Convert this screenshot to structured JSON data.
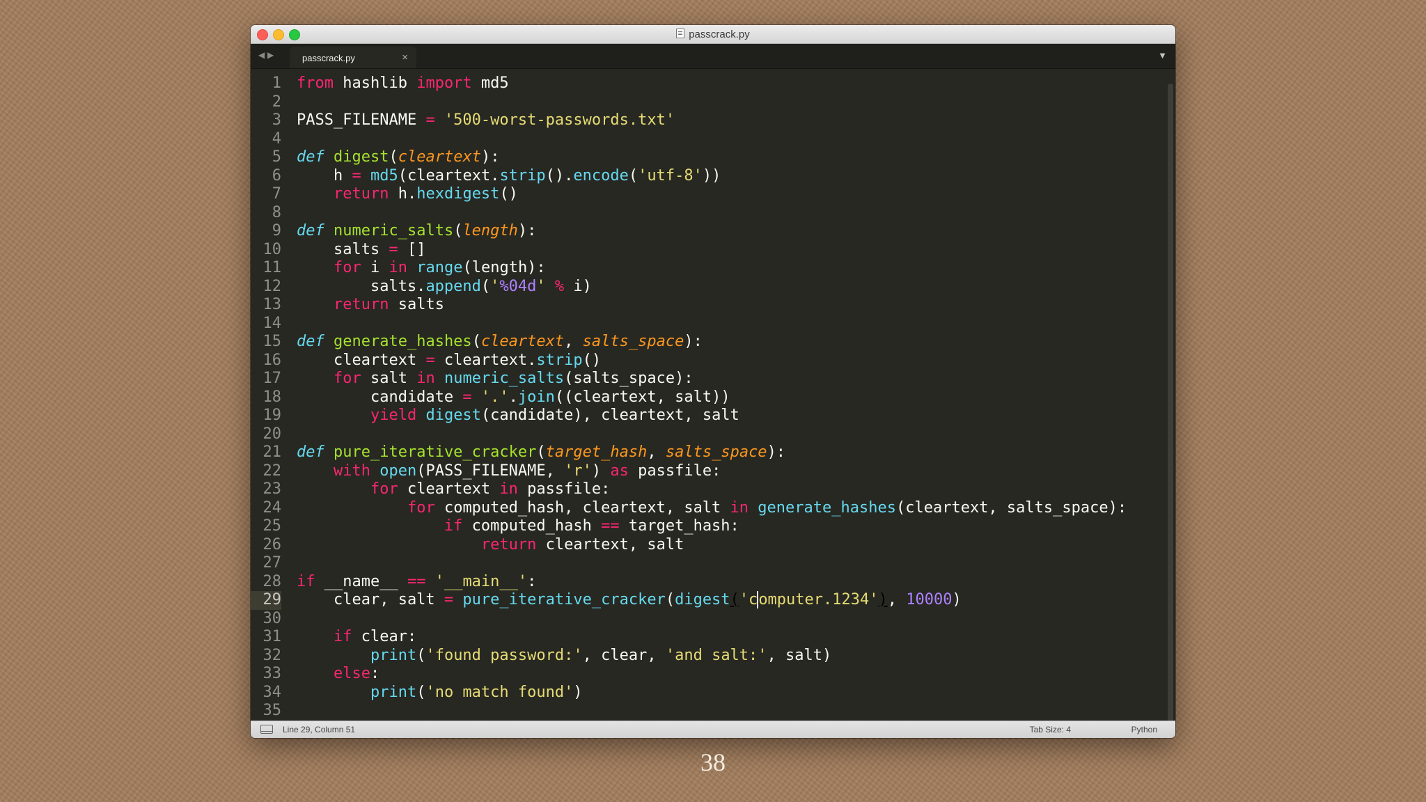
{
  "window": {
    "title": "passcrack.py"
  },
  "tabs": [
    {
      "label": "passcrack.py",
      "close": "×"
    }
  ],
  "nav": {
    "back": "◀",
    "forward": "▶",
    "dropdown": "▼"
  },
  "statusbar": {
    "position": "Line 29, Column 51",
    "tab_size": "Tab Size: 4",
    "syntax": "Python"
  },
  "slide_number": "38",
  "colors": {
    "keyword": "#f92672",
    "function": "#a6e22e",
    "builtin": "#66d9ef",
    "argument": "#fd971f",
    "string": "#e6db74",
    "number": "#ae81ff",
    "text": "#f8f8f2",
    "background": "#272822"
  },
  "editor": {
    "current_line": 29,
    "lines": [
      [
        [
          "kw",
          "from"
        ],
        [
          "pl",
          " hashlib "
        ],
        [
          "kw",
          "import"
        ],
        [
          "pl",
          " md5"
        ]
      ],
      [],
      [
        [
          "pl",
          "PASS_FILENAME "
        ],
        [
          "kw",
          "="
        ],
        [
          "pl",
          " "
        ],
        [
          "str",
          "'500-worst-passwords.txt'"
        ]
      ],
      [],
      [
        [
          "def",
          "def"
        ],
        [
          "pl",
          " "
        ],
        [
          "fn",
          "digest"
        ],
        [
          "pl",
          "("
        ],
        [
          "arg",
          "cleartext"
        ],
        [
          "pl",
          "):"
        ]
      ],
      [
        [
          "pl",
          "    h "
        ],
        [
          "kw",
          "="
        ],
        [
          "pl",
          " "
        ],
        [
          "bi",
          "md5"
        ],
        [
          "pl",
          "(cleartext."
        ],
        [
          "bi",
          "strip"
        ],
        [
          "pl",
          "()."
        ],
        [
          "bi",
          "encode"
        ],
        [
          "pl",
          "("
        ],
        [
          "str",
          "'utf-8'"
        ],
        [
          "pl",
          "))"
        ]
      ],
      [
        [
          "pl",
          "    "
        ],
        [
          "kw",
          "return"
        ],
        [
          "pl",
          " h."
        ],
        [
          "bi",
          "hexdigest"
        ],
        [
          "pl",
          "()"
        ]
      ],
      [],
      [
        [
          "def",
          "def"
        ],
        [
          "pl",
          " "
        ],
        [
          "fn",
          "numeric_salts"
        ],
        [
          "pl",
          "("
        ],
        [
          "arg",
          "length"
        ],
        [
          "pl",
          "):"
        ]
      ],
      [
        [
          "pl",
          "    salts "
        ],
        [
          "kw",
          "="
        ],
        [
          "pl",
          " []"
        ]
      ],
      [
        [
          "pl",
          "    "
        ],
        [
          "kw",
          "for"
        ],
        [
          "pl",
          " i "
        ],
        [
          "kw",
          "in"
        ],
        [
          "pl",
          " "
        ],
        [
          "bi",
          "range"
        ],
        [
          "pl",
          "(length):"
        ]
      ],
      [
        [
          "pl",
          "        salts."
        ],
        [
          "bi",
          "append"
        ],
        [
          "pl",
          "("
        ],
        [
          "str",
          "'"
        ],
        [
          "num",
          "%04d"
        ],
        [
          "str",
          "'"
        ],
        [
          "pl",
          " "
        ],
        [
          "kw",
          "%"
        ],
        [
          "pl",
          " i)"
        ]
      ],
      [
        [
          "pl",
          "    "
        ],
        [
          "kw",
          "return"
        ],
        [
          "pl",
          " salts"
        ]
      ],
      [],
      [
        [
          "def",
          "def"
        ],
        [
          "pl",
          " "
        ],
        [
          "fn",
          "generate_hashes"
        ],
        [
          "pl",
          "("
        ],
        [
          "arg",
          "cleartext"
        ],
        [
          "pl",
          ", "
        ],
        [
          "arg",
          "salts_space"
        ],
        [
          "pl",
          "):"
        ]
      ],
      [
        [
          "pl",
          "    cleartext "
        ],
        [
          "kw",
          "="
        ],
        [
          "pl",
          " cleartext."
        ],
        [
          "bi",
          "strip"
        ],
        [
          "pl",
          "()"
        ]
      ],
      [
        [
          "pl",
          "    "
        ],
        [
          "kw",
          "for"
        ],
        [
          "pl",
          " salt "
        ],
        [
          "kw",
          "in"
        ],
        [
          "pl",
          " "
        ],
        [
          "bi",
          "numeric_salts"
        ],
        [
          "pl",
          "(salts_space):"
        ]
      ],
      [
        [
          "pl",
          "        candidate "
        ],
        [
          "kw",
          "="
        ],
        [
          "pl",
          " "
        ],
        [
          "str",
          "'.'"
        ],
        [
          "pl",
          "."
        ],
        [
          "bi",
          "join"
        ],
        [
          "pl",
          "((cleartext, salt))"
        ]
      ],
      [
        [
          "pl",
          "        "
        ],
        [
          "kw",
          "yield"
        ],
        [
          "pl",
          " "
        ],
        [
          "bi",
          "digest"
        ],
        [
          "pl",
          "(candidate), cleartext, salt"
        ]
      ],
      [],
      [
        [
          "def",
          "def"
        ],
        [
          "pl",
          " "
        ],
        [
          "fn",
          "pure_iterative_cracker"
        ],
        [
          "pl",
          "("
        ],
        [
          "arg",
          "target_hash"
        ],
        [
          "pl",
          ", "
        ],
        [
          "arg",
          "salts_space"
        ],
        [
          "pl",
          "):"
        ]
      ],
      [
        [
          "pl",
          "    "
        ],
        [
          "kw",
          "with"
        ],
        [
          "pl",
          " "
        ],
        [
          "bi",
          "open"
        ],
        [
          "pl",
          "(PASS_FILENAME, "
        ],
        [
          "str",
          "'r'"
        ],
        [
          "pl",
          ") "
        ],
        [
          "kw",
          "as"
        ],
        [
          "pl",
          " passfile:"
        ]
      ],
      [
        [
          "pl",
          "        "
        ],
        [
          "kw",
          "for"
        ],
        [
          "pl",
          " cleartext "
        ],
        [
          "kw",
          "in"
        ],
        [
          "pl",
          " passfile:"
        ]
      ],
      [
        [
          "pl",
          "            "
        ],
        [
          "kw",
          "for"
        ],
        [
          "pl",
          " computed_hash, cleartext, salt "
        ],
        [
          "kw",
          "in"
        ],
        [
          "pl",
          " "
        ],
        [
          "bi",
          "generate_hashes"
        ],
        [
          "pl",
          "(cleartext, salts_space):"
        ]
      ],
      [
        [
          "pl",
          "                "
        ],
        [
          "kw",
          "if"
        ],
        [
          "pl",
          " computed_hash "
        ],
        [
          "kw",
          "=="
        ],
        [
          "pl",
          " target_hash:"
        ]
      ],
      [
        [
          "pl",
          "                    "
        ],
        [
          "kw",
          "return"
        ],
        [
          "pl",
          " cleartext, salt"
        ]
      ],
      [],
      [
        [
          "kw",
          "if"
        ],
        [
          "pl",
          " __name__ "
        ],
        [
          "kw",
          "=="
        ],
        [
          "pl",
          " "
        ],
        [
          "str",
          "'__main__'"
        ],
        [
          "pl",
          ":"
        ]
      ],
      [
        [
          "pl",
          "    clear, salt "
        ],
        [
          "kw",
          "="
        ],
        [
          "pl",
          " "
        ],
        [
          "bi",
          "pure_iterative_cracker"
        ],
        [
          "pl",
          "("
        ],
        [
          "bi",
          "digest"
        ],
        [
          "ul",
          "("
        ],
        [
          "str",
          "'c"
        ],
        [
          "caret",
          ""
        ],
        [
          "str",
          "omputer.1234'"
        ],
        [
          "ul",
          ")"
        ],
        [
          "pl",
          ", "
        ],
        [
          "num",
          "10000"
        ],
        [
          "pl",
          ")"
        ]
      ],
      [],
      [
        [
          "pl",
          "    "
        ],
        [
          "kw",
          "if"
        ],
        [
          "pl",
          " clear:"
        ]
      ],
      [
        [
          "pl",
          "        "
        ],
        [
          "bi",
          "print"
        ],
        [
          "pl",
          "("
        ],
        [
          "str",
          "'found password:'"
        ],
        [
          "pl",
          ", clear, "
        ],
        [
          "str",
          "'and salt:'"
        ],
        [
          "pl",
          ", salt)"
        ]
      ],
      [
        [
          "pl",
          "    "
        ],
        [
          "kw",
          "else"
        ],
        [
          "pl",
          ":"
        ]
      ],
      [
        [
          "pl",
          "        "
        ],
        [
          "bi",
          "print"
        ],
        [
          "pl",
          "("
        ],
        [
          "str",
          "'no match found'"
        ],
        [
          "pl",
          ")"
        ]
      ],
      []
    ]
  }
}
